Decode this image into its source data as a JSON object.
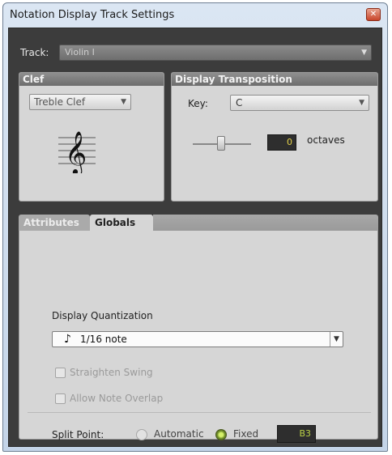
{
  "window": {
    "title": "Notation Display Track Settings",
    "close_glyph": "✕"
  },
  "track": {
    "label": "Track:",
    "value": "Violin I"
  },
  "clef": {
    "heading": "Clef",
    "selected": "Treble Clef",
    "icon": "treble-clef-icon"
  },
  "display_transposition": {
    "heading": "Display Transposition",
    "key_label": "Key:",
    "key_value": "C",
    "octave_value": "0",
    "octaves_label": "octaves"
  },
  "tabs": {
    "attributes": "Attributes",
    "globals": "Globals"
  },
  "globals": {
    "quantization_label": "Display Quantization",
    "quantization_value": "1/16 note",
    "straighten_swing_label": "Straighten Swing",
    "straighten_swing_checked": false,
    "allow_overlap_label": "Allow Note Overlap",
    "allow_overlap_checked": false,
    "split_point_label": "Split Point:",
    "automatic_label": "Automatic",
    "fixed_label": "Fixed",
    "split_mode": "Fixed",
    "split_value": "B3"
  },
  "colors": {
    "panel_bg": "#d6d6d6",
    "client_bg": "#3c3c3c",
    "numeric_field_text": "#e5d24a",
    "radio_selected": "#8db23a"
  }
}
